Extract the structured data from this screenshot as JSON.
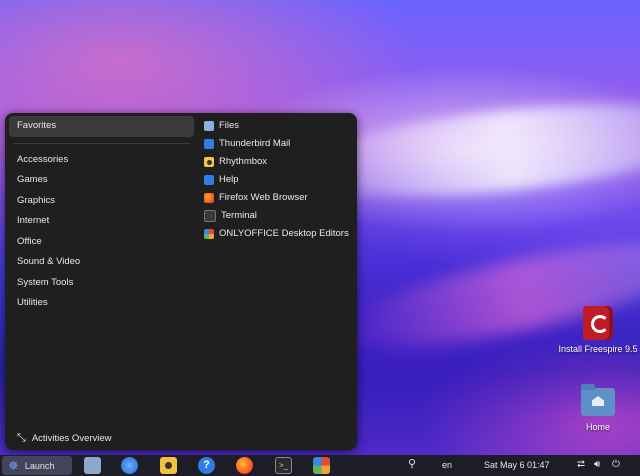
{
  "menu": {
    "categories": [
      {
        "label": "Favorites"
      },
      {
        "label": "Accessories"
      },
      {
        "label": "Games"
      },
      {
        "label": "Graphics"
      },
      {
        "label": "Internet"
      },
      {
        "label": "Office"
      },
      {
        "label": "Sound & Video"
      },
      {
        "label": "System Tools"
      },
      {
        "label": "Utilities"
      }
    ],
    "selected_category": "Favorites",
    "apps": [
      {
        "label": "Files",
        "icon": "files-icon"
      },
      {
        "label": "Thunderbird Mail",
        "icon": "thunderbird-icon"
      },
      {
        "label": "Rhythmbox",
        "icon": "rhythmbox-icon"
      },
      {
        "label": "Help",
        "icon": "help-icon"
      },
      {
        "label": "Firefox Web Browser",
        "icon": "firefox-icon"
      },
      {
        "label": "Terminal",
        "icon": "terminal-icon"
      },
      {
        "label": "ONLYOFFICE Desktop Editors",
        "icon": "onlyoffice-icon"
      }
    ],
    "activities_label": "Activities Overview"
  },
  "desktop": {
    "install_label": "Install Freespire 9.5",
    "home_label": "Home"
  },
  "taskbar": {
    "launch_label": "Launch",
    "language": "en",
    "clock": "Sat May 6  01:47",
    "help_glyph": "?"
  }
}
